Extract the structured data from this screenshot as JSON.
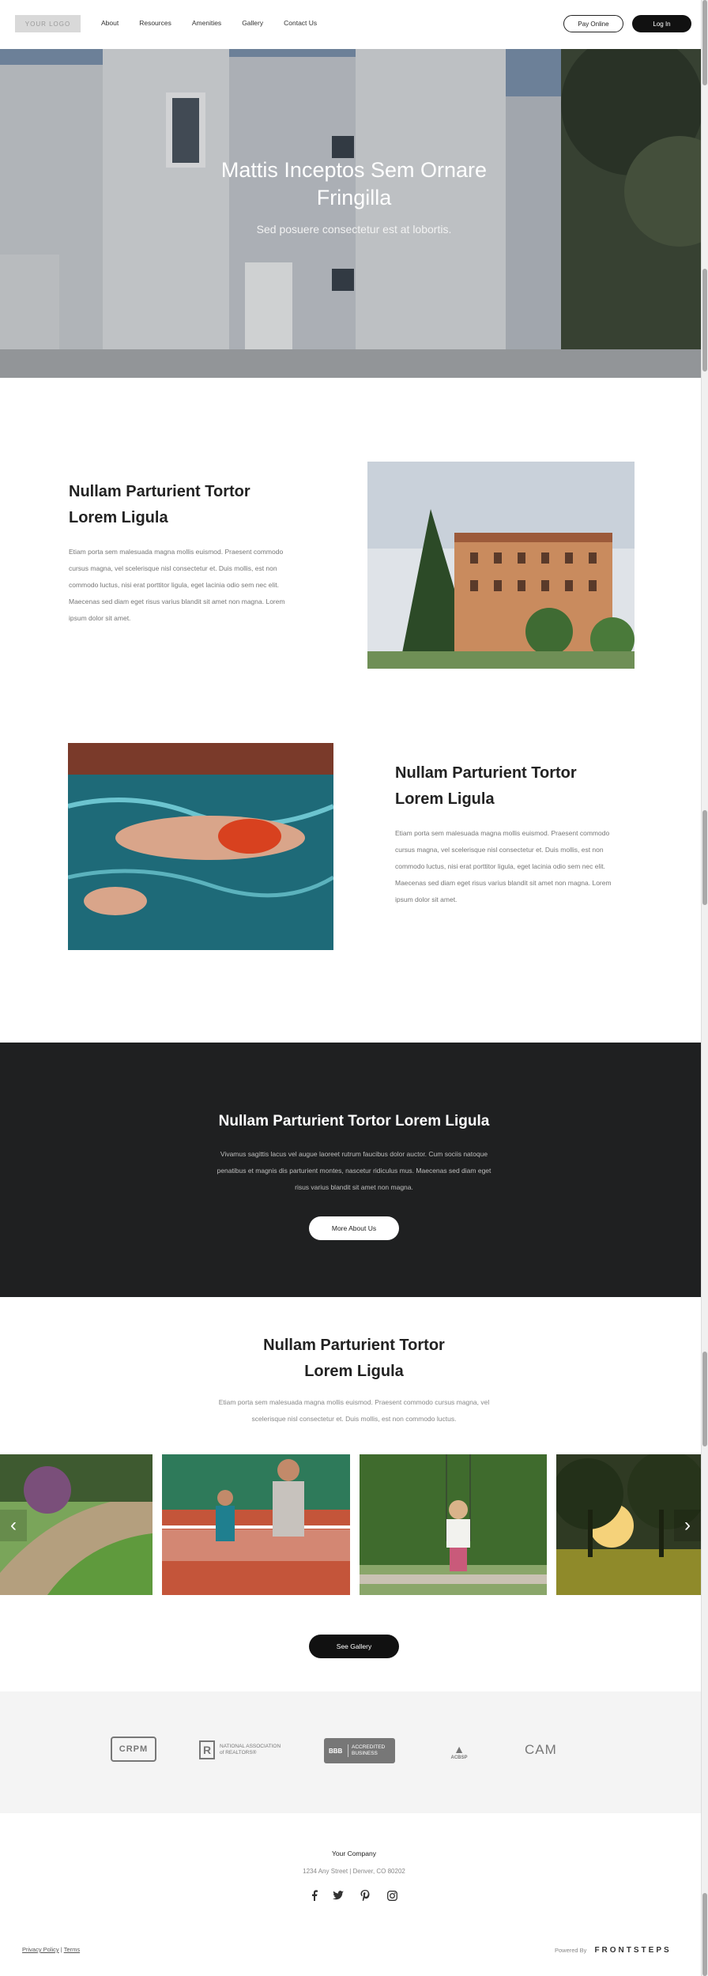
{
  "header": {
    "logo_text": "YOUR LOGO",
    "nav": [
      "About",
      "Resources",
      "Amenities",
      "Gallery",
      "Contact Us"
    ],
    "pay_online": "Pay Online",
    "log_in": "Log In"
  },
  "hero": {
    "title": "Mattis Inceptos Sem Ornare Fringilla",
    "subtitle": "Sed posuere consectetur est at lobortis."
  },
  "feature1": {
    "title": "Nullam Parturient Tortor Lorem Ligula",
    "body": "Etiam porta sem malesuada magna mollis euismod. Praesent commodo cursus magna, vel scelerisque nisl consectetur et. Duis mollis, est non commodo luctus, nisi erat porttitor ligula, eget lacinia odio sem nec elit. Maecenas sed diam eget risus varius blandit sit amet non magna. Lorem ipsum dolor sit amet."
  },
  "feature2": {
    "title": "Nullam Parturient Tortor Lorem Ligula",
    "body": "Etiam porta sem malesuada magna mollis euismod. Praesent commodo cursus magna, vel scelerisque nisl consectetur et. Duis mollis, est non commodo luctus, nisi erat porttitor ligula, eget lacinia odio sem nec elit. Maecenas sed diam eget risus varius blandit sit amet non magna. Lorem ipsum dolor sit amet."
  },
  "about": {
    "title": "Nullam Parturient Tortor Lorem Ligula",
    "body": "Vivamus sagittis lacus vel augue laoreet rutrum faucibus dolor auctor. Cum sociis natoque penatibus et magnis dis parturient montes, nascetur ridiculus mus. Maecenas sed diam eget risus varius blandit sit amet non magna.",
    "button": "More About Us"
  },
  "gallery": {
    "title": "Nullam Parturient Tortor Lorem Ligula",
    "body": "Etiam porta sem malesuada magna mollis euismod. Praesent commodo cursus magna, vel scelerisque nisl consectetur et. Duis mollis, est non commodo luctus.",
    "button": "See Gallery",
    "prev_icon": "chevron-left-icon",
    "next_icon": "chevron-right-icon"
  },
  "partners": {
    "crpm": "CRPM",
    "nar": "NATIONAL ASSOCIATION of REALTORS®",
    "bbb_line1": "ACCREDITED",
    "bbb_line2": "BUSINESS",
    "bbb_mark": "BBB",
    "acbsp": "ACBSP",
    "cam": "CAM"
  },
  "footer": {
    "company": "Your Company",
    "address": "1234 Any Street  |  Denver, CO 80202",
    "social": [
      "facebook-icon",
      "twitter-icon",
      "pinterest-icon",
      "instagram-icon"
    ],
    "privacy": "Privacy Policy",
    "separator": "|",
    "terms": "Terms",
    "powered_by": "Powered By",
    "brand": "FRONTSTEPS"
  }
}
